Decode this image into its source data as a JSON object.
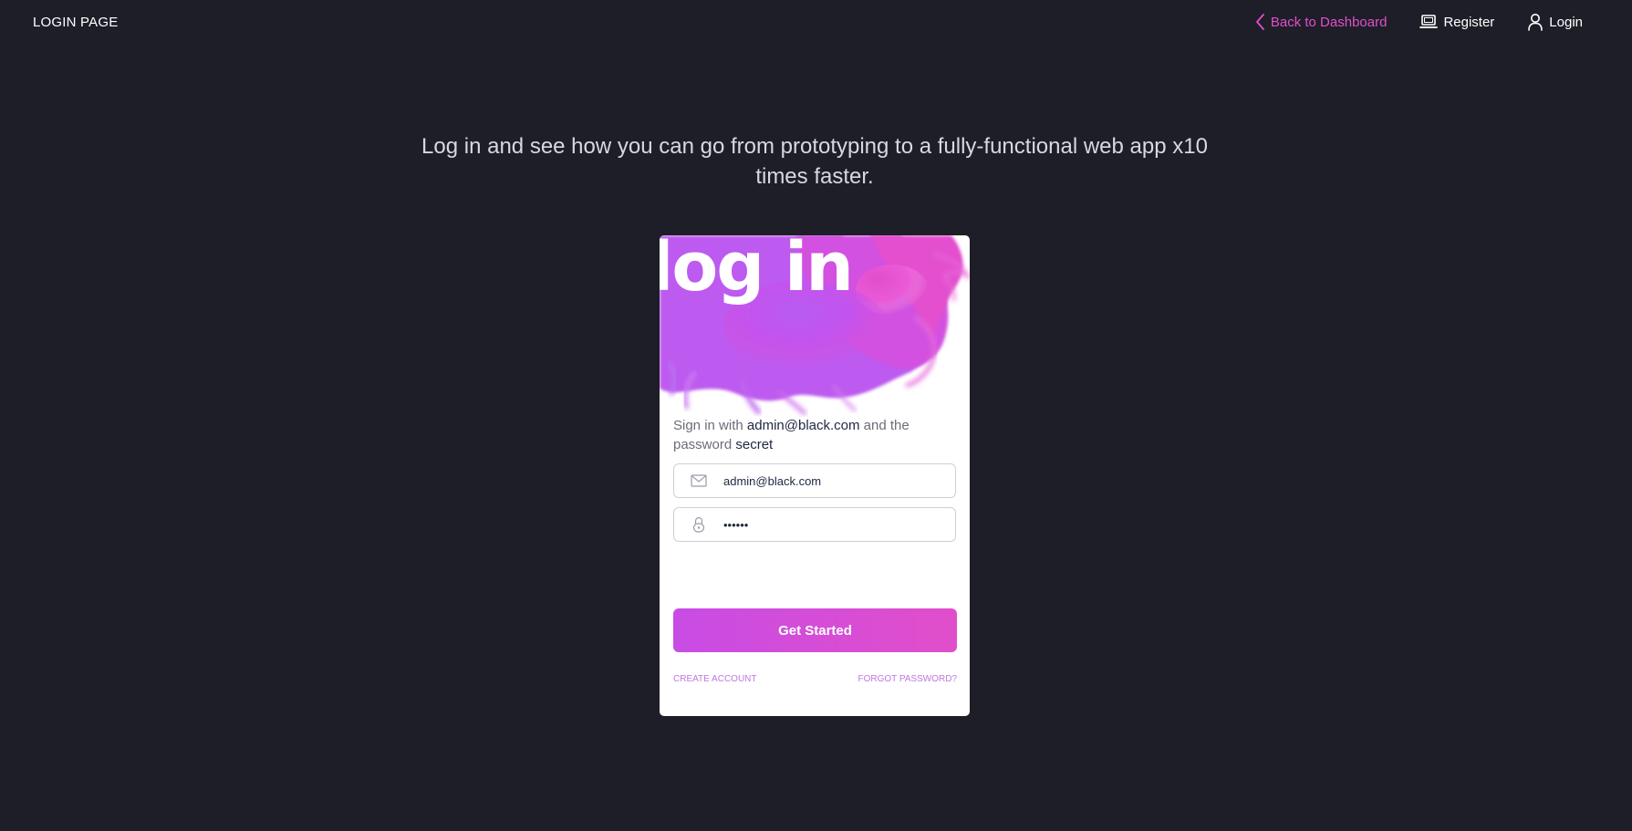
{
  "navbar": {
    "brand": "LOGIN PAGE",
    "links": [
      {
        "label": "Back to Dashboard",
        "icon": "chevron-left-icon"
      },
      {
        "label": "Register",
        "icon": "laptop-icon"
      },
      {
        "label": "Login",
        "icon": "user-icon"
      }
    ]
  },
  "headline": "Log in and see how you can go from prototyping to a fully-functional web app x10 times faster.",
  "card": {
    "title": "log in",
    "hint": {
      "prefix": "Sign in with",
      "email": "admin@black.com",
      "middle": "and the password",
      "password": "secret"
    },
    "email_field": {
      "value": "admin@black.com",
      "icon": "envelope-icon"
    },
    "password_field": {
      "value": "secret",
      "icon": "lock-icon"
    },
    "submit_label": "Get Started",
    "create_account": "Create Account",
    "forgot_password": "Forgot Password?"
  },
  "colors": {
    "background": "#1e1e28",
    "accent": "#e14eca",
    "accent_purple": "#c84ce4"
  }
}
